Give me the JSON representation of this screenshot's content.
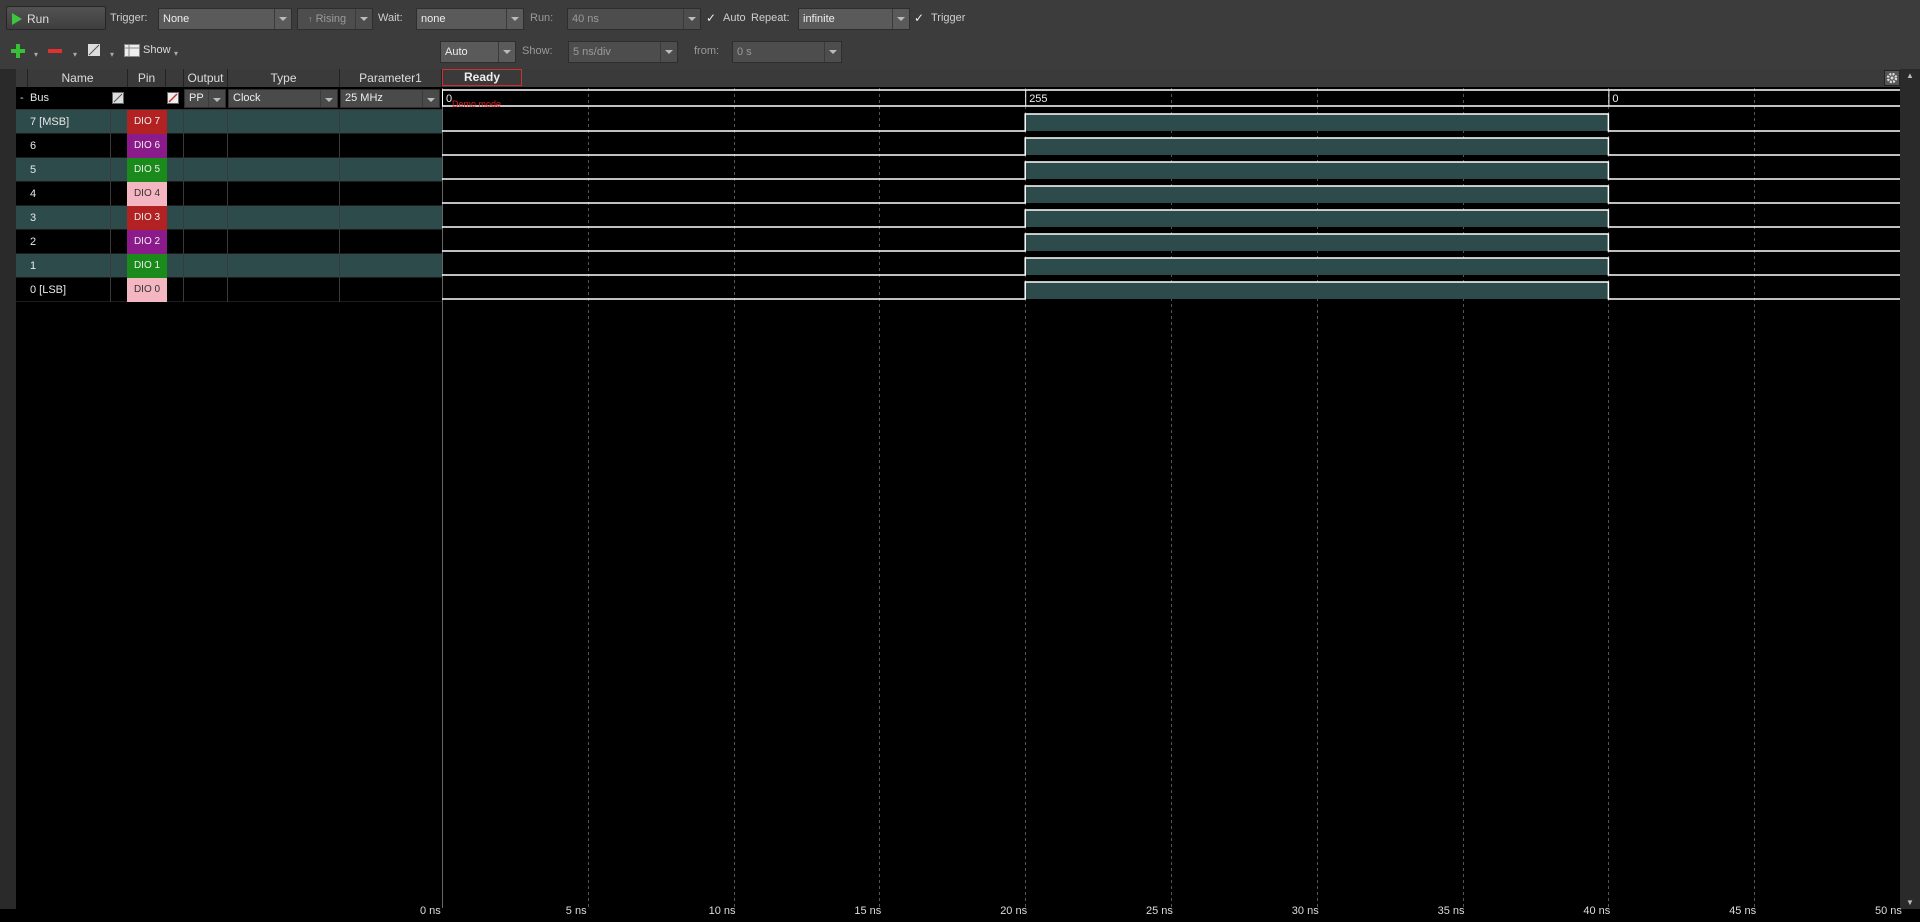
{
  "toolbar1": {
    "run_label": "Run",
    "trigger_label": "Trigger:",
    "trigger_value": "None",
    "edge_value": "Rising",
    "wait_label": "Wait:",
    "wait_value": "none",
    "run_time_label": "Run:",
    "run_time_value": "40 ns",
    "auto_label": "Auto",
    "repeat_label": "Repeat:",
    "repeat_value": "infinite",
    "trigger_check_label": "Trigger"
  },
  "toolbar2": {
    "show_label": "Show",
    "mode_value": "Auto",
    "show_label2": "Show:",
    "scale_value": "5 ns/div",
    "from_label": "from:",
    "from_value": "0 s"
  },
  "table": {
    "headers": [
      "Name",
      "Pin",
      "Output",
      "Type",
      "Parameter1"
    ],
    "status": "Ready",
    "bus": {
      "name": "Bus",
      "output": "PP",
      "type": "Clock",
      "param": "25 MHz",
      "demo_text": "Demo mode"
    },
    "rows": [
      {
        "name": "7 [MSB]",
        "pin": "DIO 7",
        "pin_color": "#b22222"
      },
      {
        "name": "6",
        "pin": "DIO 6",
        "pin_color": "#8b1a8b"
      },
      {
        "name": "5",
        "pin": "DIO 5",
        "pin_color": "#1a8a1a"
      },
      {
        "name": "4",
        "pin": "DIO 4",
        "pin_color": "#f4b6c0"
      },
      {
        "name": "3",
        "pin": "DIO 3",
        "pin_color": "#b22222"
      },
      {
        "name": "2",
        "pin": "DIO 2",
        "pin_color": "#8b1a8b"
      },
      {
        "name": "1",
        "pin": "DIO 1",
        "pin_color": "#1a8a1a"
      },
      {
        "name": "0 [LSB]",
        "pin": "DIO 0",
        "pin_color": "#f4b6c0"
      }
    ]
  },
  "waveform": {
    "bus_values": [
      "0",
      "255",
      "0"
    ],
    "transitions_ns": [
      0,
      20,
      40
    ],
    "time_range_ns": [
      0,
      50
    ],
    "time_ticks": [
      "0 ns",
      "5 ns",
      "10 ns",
      "15 ns",
      "20 ns",
      "25 ns",
      "30 ns",
      "35 ns",
      "40 ns",
      "45 ns",
      "50 ns"
    ],
    "signal_high_color": "#2e4b4b",
    "signal_edge_color": "#ffffff"
  }
}
